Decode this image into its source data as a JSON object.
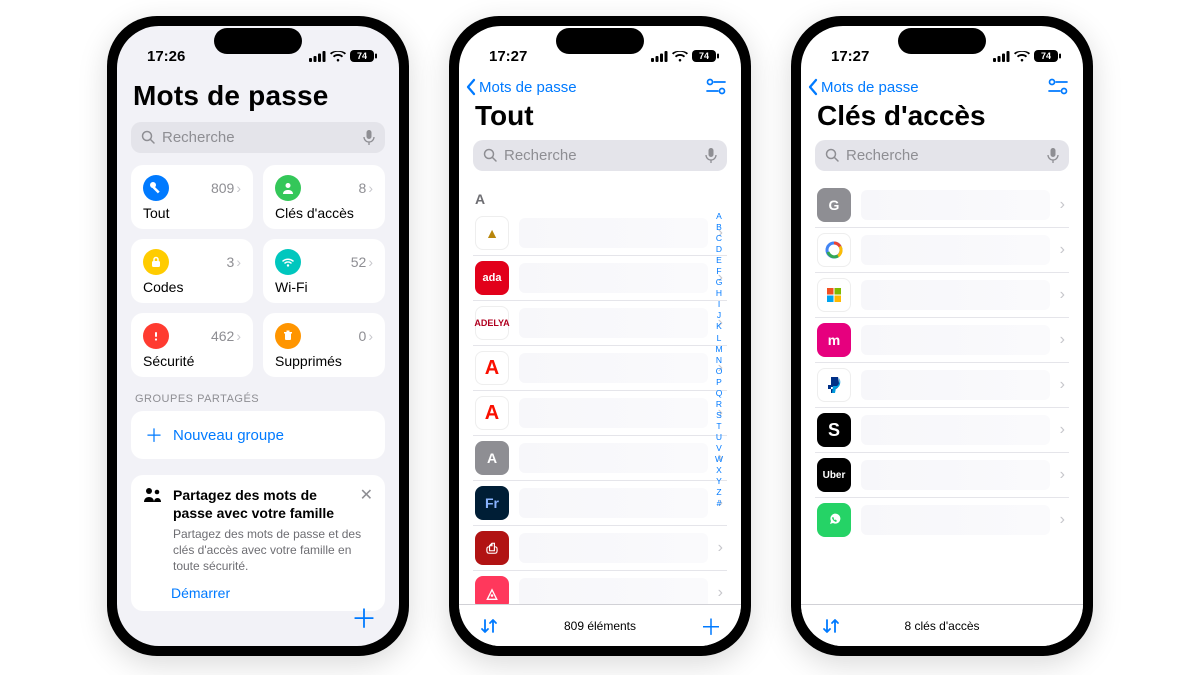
{
  "phones": {
    "home": {
      "time": "17:26",
      "battery": "74",
      "title": "Mots de passe",
      "search_placeholder": "Recherche",
      "tiles": {
        "all": {
          "label": "Tout",
          "count": "809",
          "color": "#007aff"
        },
        "passkeys": {
          "label": "Clés d'accès",
          "count": "8",
          "color": "#34c759"
        },
        "codes": {
          "label": "Codes",
          "count": "3",
          "color": "#ffcc00"
        },
        "wifi": {
          "label": "Wi-Fi",
          "count": "52",
          "color": "#00c7be"
        },
        "security": {
          "label": "Sécurité",
          "count": "462",
          "color": "#ff3b30"
        },
        "deleted": {
          "label": "Supprimés",
          "count": "0",
          "color": "#ff9500"
        }
      },
      "groups_header": "Groupes partagés",
      "new_group": "Nouveau groupe",
      "promo": {
        "title": "Partagez des mots de passe avec votre famille",
        "body": "Partagez des mots de passe et des clés d'accès avec votre famille en toute sécurité.",
        "cta": "Démarrer"
      }
    },
    "all": {
      "time": "17:27",
      "battery": "74",
      "back": "Mots de passe",
      "title": "Tout",
      "search_placeholder": "Recherche",
      "section": "A",
      "footer": "809 éléments",
      "index": [
        "A",
        "B",
        "C",
        "D",
        "E",
        "F",
        "G",
        "H",
        "I",
        "J",
        "K",
        "L",
        "M",
        "N",
        "O",
        "P",
        "Q",
        "R",
        "S",
        "T",
        "U",
        "V",
        "W",
        "X",
        "Y",
        "Z",
        "#"
      ]
    },
    "passkeys": {
      "time": "17:27",
      "battery": "74",
      "back": "Mots de passe",
      "title": "Clés d'accès",
      "search_placeholder": "Recherche",
      "footer": "8 clés d'accès"
    }
  }
}
